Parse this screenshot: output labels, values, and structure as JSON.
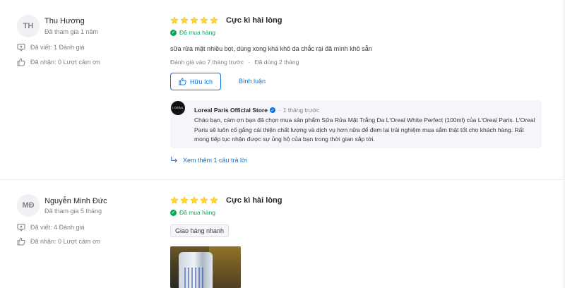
{
  "reviews": [
    {
      "avatar_initials": "TH",
      "name": "Thu Hương",
      "joined": "Đã tham gia 1 năm",
      "written_label": "Đã viết: 1 Đánh giá",
      "received_label": "Đã nhận: 0 Lượt cảm ơn",
      "rating": 5,
      "rating_title": "Cực kì hài lòng",
      "verified_label": "Đã mua hàng",
      "content": "sữa rửa mặt nhiều bọt, dùng xong khá khô da chắc rại đã mình khô sẵn",
      "review_time": "Đánh giá vào 7 tháng trước",
      "usage_time": "Đã dùng 2 tháng",
      "helpful_label": "Hữu ích",
      "comment_label": "Bình luận",
      "reply": {
        "logo_text": "L'ORÉAL",
        "store_name": "Loreal Paris Official Store",
        "time": "1 tháng trước",
        "text": "Chào bạn, cám ơn bạn đã chọn mua sản phẩm Sữa Rửa Mặt Trắng Da L'Oreal White Perfect (100ml) của L'Oreal Paris. L'Oreal Paris sẽ luôn cố gắng cải thiện chất lượng và dịch vụ hơn nữa để đem lại trải nghiệm mua sắm thật tốt cho khách hàng. Rất mong tiếp tục nhận được sự ủng hộ của bạn trong thời gian sắp tới."
      },
      "see_more_label": "Xem thêm 1 câu trả lời"
    },
    {
      "avatar_initials": "MĐ",
      "name": "Nguyễn Minh Đức",
      "joined": "Đã tham gia 5 tháng",
      "written_label": "Đã viết: 4 Đánh giá",
      "received_label": "Đã nhận: 0 Lượt cảm ơn",
      "rating": 5,
      "rating_title": "Cực kì hài lòng",
      "verified_label": "Đã mua hàng",
      "tag": "Giao hàng nhanh"
    }
  ],
  "colors": {
    "star": "#fdd835",
    "accent": "#0b74e5",
    "verified": "#00ab56"
  }
}
